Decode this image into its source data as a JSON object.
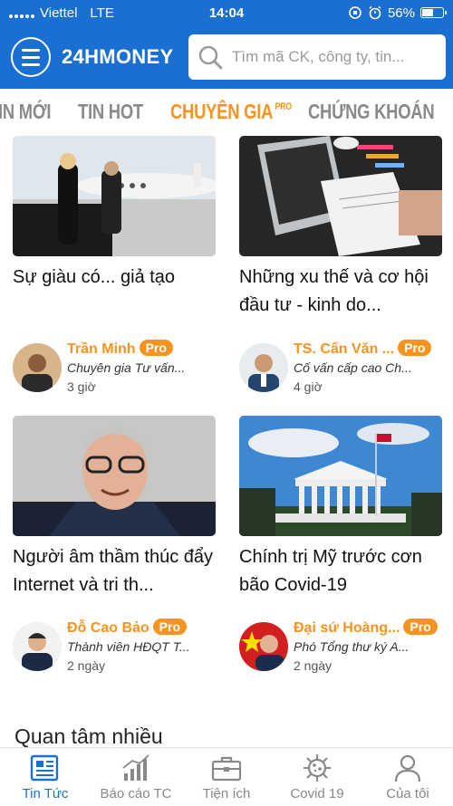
{
  "status_bar": {
    "carrier": "Viettel",
    "network": "LTE",
    "time": "14:04",
    "battery": "56%",
    "battery_level": 0.56
  },
  "header": {
    "logo": "24HMONEY",
    "search_placeholder": "Tìm mã CK, công ty, tin...",
    "brand_color": "#1a6fd0"
  },
  "tabs": [
    {
      "label": "IN MỚI",
      "active": false
    },
    {
      "label": "TIN HOT",
      "active": false
    },
    {
      "label": "CHUYÊN GIA",
      "badge": "PRO",
      "active": true
    },
    {
      "label": "CHỨNG KHOÁN",
      "active": false
    }
  ],
  "articles": [
    {
      "title": "Sự giàu có... giả tạo",
      "author": "Trần Minh",
      "badge": "Pro",
      "role": "Chuyên gia  Tư vấn...",
      "time": "3 giờ",
      "image": "jet-couple-photo"
    },
    {
      "title": "Những xu thế và cơ hội đầu tư - kinh do...",
      "author": "TS. Cấn Văn ...",
      "badge": "Pro",
      "role": "Cố vấn cấp cao Ch...",
      "time": "4 giờ",
      "image": "laptop-desk-photo"
    },
    {
      "title": "Người âm thầm thúc đẩy Internet và tri th...",
      "author": "Đỗ Cao Bảo",
      "badge": "Pro",
      "role": "Thành viên HĐQT T...",
      "time": "2 ngày",
      "image": "portrait-photo"
    },
    {
      "title": "Chính trị Mỹ trước cơn bão Covid-19",
      "author": "Đại sứ Hoàng...",
      "badge": "Pro",
      "role": "Phó Tổng thư ký A...",
      "time": "2 ngày",
      "image": "capitol-building-photo"
    }
  ],
  "section_title": "Quan tâm nhiều",
  "bottom_nav": [
    {
      "label": "Tin Tức",
      "icon": "newspaper-icon",
      "active": true
    },
    {
      "label": "Báo cáo TC",
      "icon": "bar-chart-icon",
      "active": false
    },
    {
      "label": "Tiện ích",
      "icon": "briefcase-icon",
      "active": false
    },
    {
      "label": "Covid 19",
      "icon": "virus-icon",
      "active": false
    },
    {
      "label": "Của tôi",
      "icon": "user-icon",
      "active": false
    }
  ],
  "colors": {
    "accent": "#f7931e",
    "active_nav": "#1a6fd0",
    "inactive": "#888888"
  }
}
